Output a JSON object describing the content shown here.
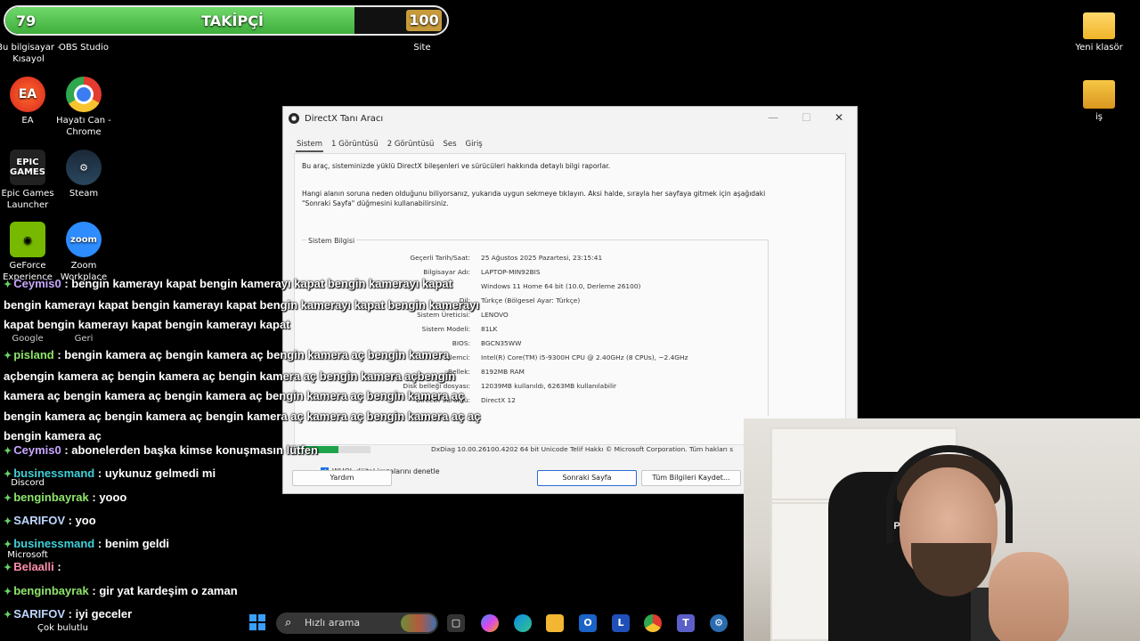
{
  "follow_bar": {
    "current": "79",
    "label": "TAKİPÇİ",
    "goal": "100",
    "progress": 0.79
  },
  "desktop_icons": {
    "this_pc": "Bu bilgisayar - Kısayol",
    "obs": "OBS Studio",
    "site": "Site",
    "ea": "EA",
    "chrome": "Hayatı Can - Chrome",
    "epic": "Epic Games Launcher",
    "epic_logo": "EPIC GAMES",
    "steam": "Steam",
    "geforce": "GeForce Experience",
    "zoom": "Zoom Workplace",
    "zoom_logo": "zoom",
    "google": "Google",
    "geri": "Geri",
    "discord": "Discord",
    "microsoft": "Microsoft",
    "new_folder": "Yeni klasör",
    "is": "iş"
  },
  "dxdiag": {
    "title": "DirectX Tanı Aracı",
    "tabs": [
      "Sistem",
      "1 Görüntüsü",
      "2 Görüntüsü",
      "Ses",
      "Giriş"
    ],
    "intro1": "Bu araç, sisteminizde yüklü DirectX bileşenleri ve sürücüleri hakkında detaylı bilgi raporlar.",
    "intro2a": "Hangi alanın soruna neden olduğunu biliyorsanız, yukarıda uygun sekmeye tıklayın. Aksi halde, sırayla her sayfaya gitmek için aşağıdaki",
    "intro2b": "\"Sonraki Sayfa\" düğmesini kullanabilirsiniz.",
    "group_title": "Sistem Bilgisi",
    "rows": [
      {
        "k": "Geçerli Tarih/Saat:",
        "v": "25 Ağustos 2025 Pazartesi, 23:15:41"
      },
      {
        "k": "Bilgisayar Adı:",
        "v": "LAPTOP-MIN92BIS"
      },
      {
        "k": "",
        "v": "Windows 11 Home 64 bit (10.0, Derleme 26100)"
      },
      {
        "k": "Dil:",
        "v": "Türkçe (Bölgesel Ayar: Türkçe)"
      },
      {
        "k": "Sistem Üreticisi:",
        "v": "LENOVO"
      },
      {
        "k": "Sistem Modeli:",
        "v": "81LK"
      },
      {
        "k": "BIOS:",
        "v": "BGCN35WW"
      },
      {
        "k": "İşlemci:",
        "v": "Intel(R) Core(TM) i5-9300H CPU @ 2.40GHz (8 CPUs), ~2.4GHz"
      },
      {
        "k": "Bellek:",
        "v": "8192MB RAM"
      },
      {
        "k": "Disk belleği dosyası:",
        "v": "12039MB kullanıldı, 6263MB kullanılabilir"
      },
      {
        "k": "DirectX Sürümü:",
        "v": "DirectX 12"
      }
    ],
    "whql": "WHQL dijital imzalarını denetle",
    "footer": "DxDiag 10.00.26100.4202 64 bit Unicode  Telif Hakkı © Microsoft Corporation. Tüm hakları s",
    "btn_help": "Yardım",
    "btn_next": "Sonraki Sayfa",
    "btn_save": "Tüm Bilgileri Kaydet..."
  },
  "chat": [
    {
      "user": "Ceymis0",
      "user_color": "#c9a7ff",
      "text": "bengin kamerayı kapat bengin kamerayı kapat bengin kamerayı kapat bengin kamerayı kapat bengin kamerayı kapat bengin kamerayı kapat bengin kamerayı kapat bengin kamerayı kapat bengin kamerayı kapat"
    },
    {
      "user": "pisland",
      "user_color": "#8fe66b",
      "text": "bengin kamera aç bengin kamera aç bengin kamera aç bengin kamera açbengin kamera aç bengin kamera aç bengin kamera aç bengin kamera açbengin kamera aç bengin kamera aç bengin kamera aç bengin kamera aç bengin kamera aç bengin kamera aç bengin kamera aç bengin kamera aç kamera aç bengin kamera aç aç bengin kamera aç"
    },
    {
      "user": "Ceymis0",
      "user_color": "#c9a7ff",
      "text": "abonelerden başka kimse konuşmasın lütfen"
    },
    {
      "user": "businessmand",
      "user_color": "#3fd1d9",
      "text": "uykunuz gelmedi mi"
    },
    {
      "user": "benginbayrak",
      "user_color": "#8fe66b",
      "text": "yooo"
    },
    {
      "user": "SARIFOV",
      "user_color": "#bfd7ff",
      "text": "yoo"
    },
    {
      "user": "businessmand",
      "user_color": "#3fd1d9",
      "text": "benim geldi"
    },
    {
      "user": "Belaalli",
      "user_color": "#ff8fa8",
      "text": ""
    },
    {
      "user": "benginbayrak",
      "user_color": "#8fe66b",
      "text": "gir yat kardeşim o zaman"
    },
    {
      "user": "SARIFOV",
      "user_color": "#bfd7ff",
      "text": "iyi geceler"
    }
  ],
  "webcam": {
    "chair_logo": "XPRIM"
  },
  "taskbar": {
    "weather": "Çok bulutlu",
    "search_placeholder": "Hızlı arama",
    "apps": [
      "file-explorer",
      "copilot",
      "edge",
      "folder",
      "outlook",
      "L",
      "chrome",
      "teams",
      "settings"
    ]
  },
  "colors": {
    "accent_green": "#3fae3c",
    "dx_primary": "#2d6bd6"
  }
}
